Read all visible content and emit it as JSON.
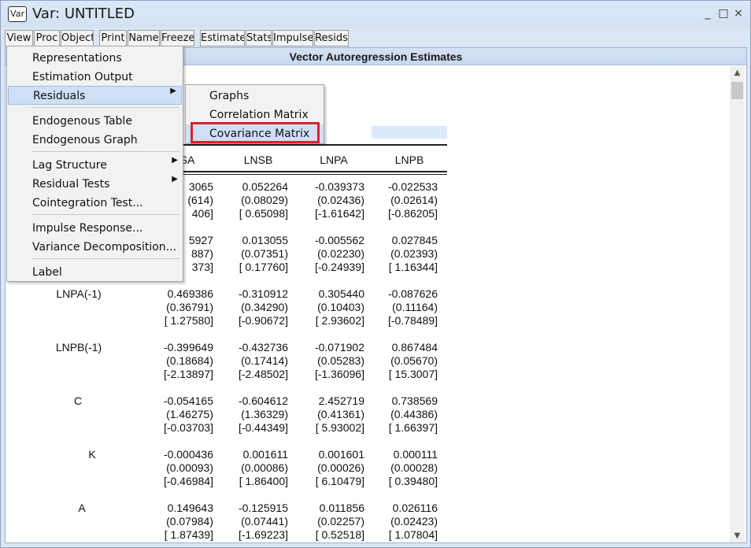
{
  "window": {
    "icon_text": "Var",
    "title": "Var: UNTITLED",
    "controls": [
      "_",
      "□",
      "×"
    ]
  },
  "toolbar": [
    "View",
    "Proc",
    "Object",
    "Print",
    "Name",
    "Freeze",
    "Estimate",
    "Stats",
    "Impulse",
    "Resids"
  ],
  "header": "Vector Autoregression Estimates",
  "table": {
    "column_headers": [
      "SA",
      "LNSB",
      "LNPA",
      "LNPB"
    ],
    "rows": [
      {
        "label": "",
        "values": [
          [
            "3065",
            "(614)",
            "406]"
          ],
          [
            "0.052264",
            "(0.08029)",
            "[ 0.65098]"
          ],
          [
            "-0.039373",
            "(0.02436)",
            "[-1.61642]"
          ],
          [
            "-0.022533",
            "(0.02614)",
            "[-0.86205]"
          ]
        ]
      },
      {
        "label": "",
        "values": [
          [
            "5927",
            "887)",
            "373]"
          ],
          [
            "0.013055",
            "(0.07351)",
            "[ 0.17760]"
          ],
          [
            "-0.005562",
            "(0.02230)",
            "[-0.24939]"
          ],
          [
            "0.027845",
            "(0.02393)",
            "[ 1.16344]"
          ]
        ]
      },
      {
        "label": "LNPA(-1)",
        "values": [
          [
            "0.469386",
            "(0.36791)",
            "[ 1.27580]"
          ],
          [
            "-0.310912",
            "(0.34290)",
            "[-0.90672]"
          ],
          [
            "0.305440",
            "(0.10403)",
            "[ 2.93602]"
          ],
          [
            "-0.087626",
            "(0.11164)",
            "[-0.78489]"
          ]
        ]
      },
      {
        "label": "LNPB(-1)",
        "values": [
          [
            "-0.399649",
            "(0.18684)",
            "[-2.13897]"
          ],
          [
            "-0.432736",
            "(0.17414)",
            "[-2.48502]"
          ],
          [
            "-0.071902",
            "(0.05283)",
            "[-1.36096]"
          ],
          [
            "0.867484",
            "(0.05670)",
            "[ 15.3007]"
          ]
        ]
      },
      {
        "label": "C",
        "values": [
          [
            "-0.054165",
            "(1.46275)",
            "[-0.03703]"
          ],
          [
            "-0.604612",
            "(1.36329)",
            "[-0.44349]"
          ],
          [
            "2.452719",
            "(0.41361)",
            "[ 5.93002]"
          ],
          [
            "0.738569",
            "(0.44386)",
            "[ 1.66397]"
          ]
        ]
      },
      {
        "label": "K",
        "values": [
          [
            "-0.000436",
            "(0.00093)",
            "[-0.46984]"
          ],
          [
            "0.001611",
            "(0.00086)",
            "[ 1.86400]"
          ],
          [
            "0.001601",
            "(0.00026)",
            "[ 6.10479]"
          ],
          [
            "0.000111",
            "(0.00028)",
            "[ 0.39480]"
          ]
        ]
      },
      {
        "label": "A",
        "values": [
          [
            "0.149643",
            "(0.07984)",
            "[ 1.87439]"
          ],
          [
            "-0.125915",
            "(0.07441)",
            "[-1.69223]"
          ],
          [
            "0.011856",
            "(0.02257)",
            "[ 0.52518]"
          ],
          [
            "0.026116",
            "(0.02423)",
            "[ 1.07804]"
          ]
        ]
      }
    ]
  },
  "view_menu": {
    "groups": [
      [
        "Representations",
        "Estimation Output",
        "Residuals"
      ],
      [
        "Endogenous Table",
        "Endogenous Graph"
      ],
      [
        "Lag Structure",
        "Residual Tests",
        "Cointegration Test..."
      ],
      [
        "Impulse Response...",
        "Variance Decomposition..."
      ],
      [
        "Label"
      ]
    ],
    "active": "Residuals",
    "submenu_items": [
      "Lag Structure",
      "Residual Tests",
      "Residuals"
    ]
  },
  "residuals_submenu": {
    "items": [
      "Graphs",
      "Correlation Matrix",
      "Covariance Matrix"
    ],
    "highlighted": "Covariance Matrix"
  },
  "colors": {
    "highlight": "#cfe0f6",
    "callout": "#e0202a"
  }
}
